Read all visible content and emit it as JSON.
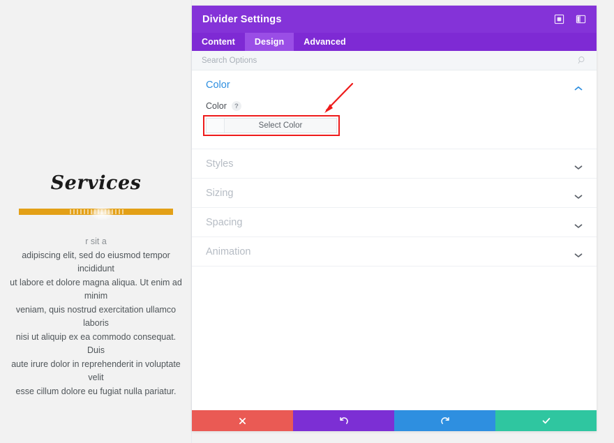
{
  "preview": {
    "heading": "Services",
    "divider_color": "#e3a017",
    "body_line_partial": "r sit a",
    "body_lines": [
      "adipiscing elit, sed do eiusmod tempor incididunt",
      "ut labore et dolore magna aliqua. Ut enim ad minim",
      "veniam, quis nostrud exercitation ullamco laboris",
      "nisi ut aliquip ex ea commodo consequat. Duis",
      "aute irure dolor in reprehenderit in voluptate velit",
      "esse cillum dolore eu fugiat nulla pariatur."
    ]
  },
  "panel": {
    "title": "Divider Settings",
    "header_icons": [
      {
        "name": "target-icon",
        "label": "Focus Module"
      },
      {
        "name": "layout-panel-icon",
        "label": "Toggle Panel Position"
      }
    ],
    "tabs": [
      {
        "label": "Content",
        "active": false
      },
      {
        "label": "Design",
        "active": true
      },
      {
        "label": "Advanced",
        "active": false
      }
    ],
    "search": {
      "placeholder": "Search Options",
      "value": ""
    },
    "sections": [
      {
        "label": "Color",
        "state": "expanded",
        "chevron": "chevron-up-icon",
        "field": {
          "label": "Color",
          "help": "?",
          "button_label": "Select Color",
          "swatch_color": "#fafbfc"
        }
      },
      {
        "label": "Styles",
        "state": "collapsed",
        "chevron": "chevron-down-icon"
      },
      {
        "label": "Sizing",
        "state": "collapsed",
        "chevron": "chevron-down-icon"
      },
      {
        "label": "Spacing",
        "state": "collapsed",
        "chevron": "chevron-down-icon"
      },
      {
        "label": "Animation",
        "state": "collapsed",
        "chevron": "chevron-down-icon"
      }
    ],
    "footer_buttons": [
      {
        "name": "cancel-button",
        "glyph": "✖",
        "color": "#ea5a54"
      },
      {
        "name": "undo-button",
        "glyph": "↺",
        "color": "#7c2fd4"
      },
      {
        "name": "redo-button",
        "glyph": "↻",
        "color": "#2e8fe0"
      },
      {
        "name": "save-button",
        "glyph": "✔",
        "color": "#2fc6a0"
      }
    ]
  },
  "annotation": {
    "arrow_color": "#ee1b1b",
    "highlight_color": "#ee1b1b"
  },
  "colors": {
    "header_purple": "#8433d8",
    "tab_bar_purple": "#7e2ad4",
    "tab_active_purple": "#9a4ee6",
    "accent_blue": "#2e8fe0",
    "section_gray": "#b6bcc4"
  }
}
